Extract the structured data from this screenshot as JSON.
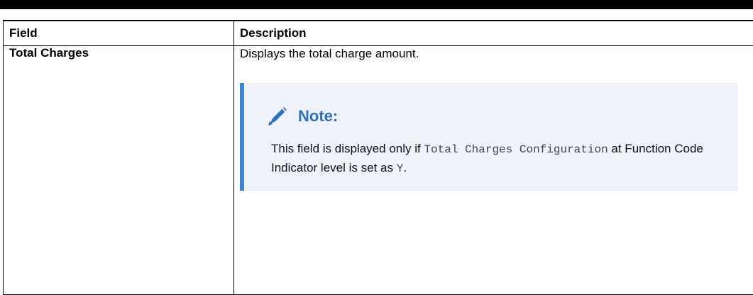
{
  "table": {
    "headers": [
      "Field",
      "Description"
    ],
    "rows": [
      {
        "field": "Total Charges",
        "description": "Displays the total charge amount.",
        "note": {
          "icon": "pencil-icon",
          "title": "Note:",
          "text_1": "This field is displayed only if ",
          "code_1": "Total Charges Configuration",
          "text_2": " at Function Code Indicator level is set as ",
          "code_2": "Y",
          "text_3": "."
        }
      }
    ]
  },
  "colors": {
    "note_accent": "#3f86d6",
    "note_background": "#eef3fb",
    "note_title": "#2f6fbf"
  }
}
